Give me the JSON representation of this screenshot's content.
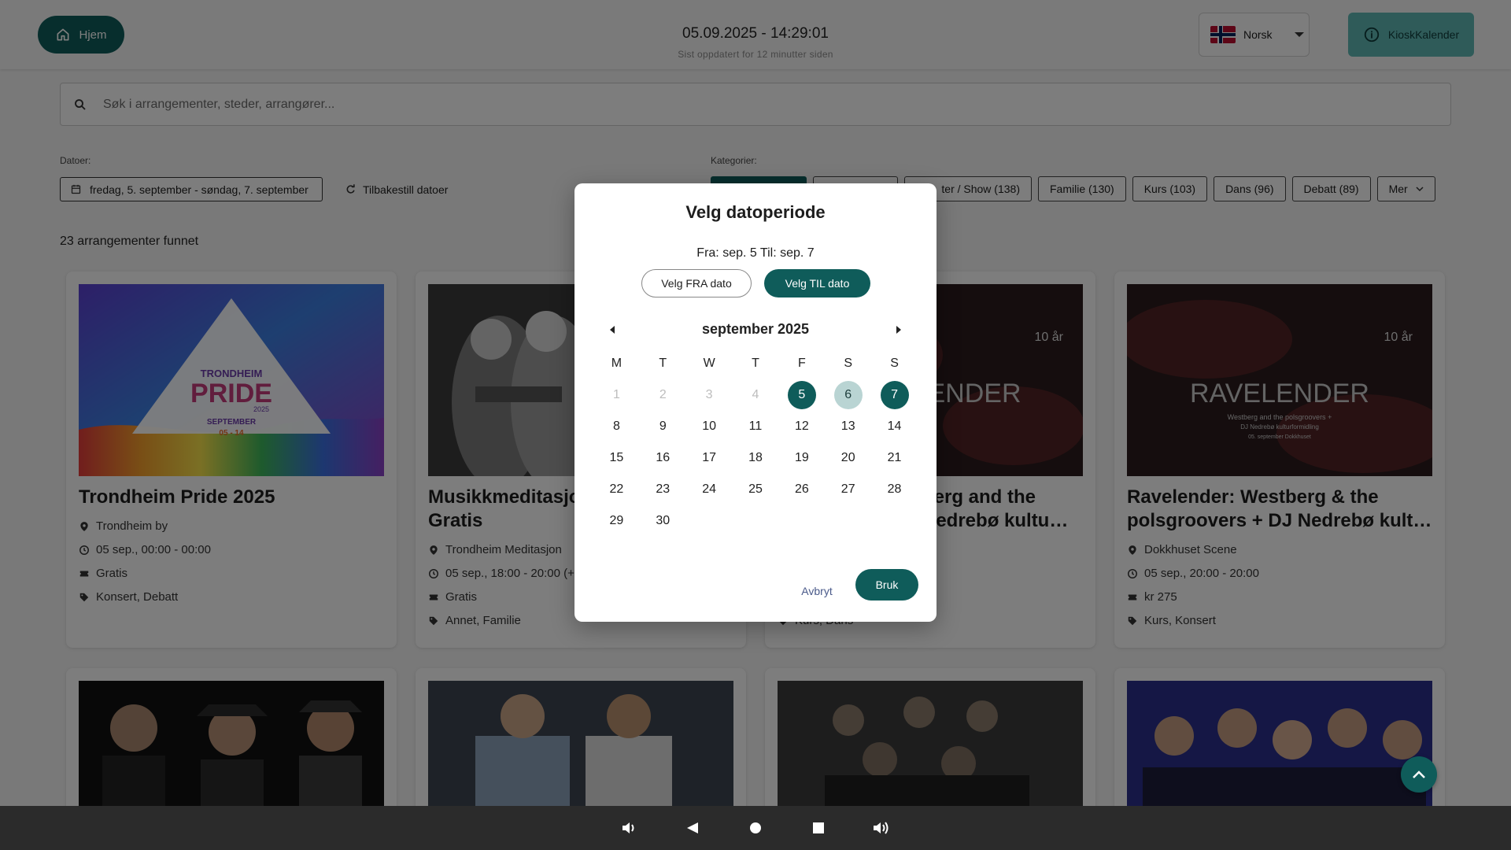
{
  "header": {
    "home_label": "Hjem",
    "datetime": "05.09.2025 - 14:29:01",
    "updated": "Sist oppdatert for 12 minutter siden",
    "language": "Norsk",
    "kiosk_label": "KioskKalender"
  },
  "search": {
    "placeholder": "Søk i arrangementer, steder, arrangører..."
  },
  "filters": {
    "dates_label": "Datoer:",
    "date_range": "fredag, 5. september - søndag, 7. september",
    "reset_label": "Tilbakestill datoer",
    "categories_label": "Kategorier:",
    "categories": [
      "",
      "",
      "ter / Show (138)",
      "Familie (130)",
      "Kurs (103)",
      "Dans (96)",
      "Debatt (89)"
    ],
    "more_label": "Mer"
  },
  "results_count": "23 arrangementer funnet",
  "cards": [
    {
      "title": "Trondheim Pride 2025",
      "location": "Trondheim by",
      "time": "05 sep., 00:00 - 00:00",
      "price": "Gratis",
      "tags": "Konsert, Debatt"
    },
    {
      "title": "Musikkmeditasjo\nGratis",
      "location": "Trondheim Meditasjon",
      "time": "05 sep., 18:00 - 20:00 (+",
      "price": "Gratis",
      "tags": "Annet, Familie"
    },
    {
      "title": "berg and the\n Nedrebø kultu…",
      "location": "",
      "time": "",
      "price": "",
      "tags": "Kurs, Dans"
    },
    {
      "title": "Ravelender: Westberg & the polsgroovers + DJ Nedrebø kult…",
      "location": "Dokkhuset Scene",
      "time": "05 sep., 20:00 - 20:00",
      "price": "kr 275",
      "tags": "Kurs, Konsert"
    }
  ],
  "card_images": {
    "pride_title_line1": "TRONDHEIM",
    "pride_title_line2": "PRIDE",
    "pride_year": "2025",
    "pride_month": "SEPTEMBER",
    "pride_dates": "05 - 14",
    "rave_badge": "10 år",
    "rave_title": "RAVELENDER",
    "rave_sub1": "Westberg and the polsgroovers +",
    "rave_sub2": "DJ Nedrebø kulturformidling",
    "rave_sub3": "05. september Dokkhuset",
    "rave3_title": "ENDER",
    "rave3_badge": "10 år"
  },
  "dialog": {
    "title": "Velg datoperiode",
    "range": "Fra: sep. 5 Til: sep. 7",
    "from_btn": "Velg FRA dato",
    "to_btn": "Velg TIL dato",
    "month": "september 2025",
    "weekdays": [
      "M",
      "T",
      "W",
      "T",
      "F",
      "S",
      "S"
    ],
    "days": [
      {
        "d": "1",
        "s": "muted"
      },
      {
        "d": "2",
        "s": "muted"
      },
      {
        "d": "3",
        "s": "muted"
      },
      {
        "d": "4",
        "s": "muted"
      },
      {
        "d": "5",
        "s": "sel"
      },
      {
        "d": "6",
        "s": "mid"
      },
      {
        "d": "7",
        "s": "sel"
      },
      {
        "d": "8"
      },
      {
        "d": "9"
      },
      {
        "d": "10"
      },
      {
        "d": "11"
      },
      {
        "d": "12"
      },
      {
        "d": "13"
      },
      {
        "d": "14"
      },
      {
        "d": "15"
      },
      {
        "d": "16"
      },
      {
        "d": "17"
      },
      {
        "d": "18"
      },
      {
        "d": "19"
      },
      {
        "d": "20"
      },
      {
        "d": "21"
      },
      {
        "d": "22"
      },
      {
        "d": "23"
      },
      {
        "d": "24"
      },
      {
        "d": "25"
      },
      {
        "d": "26"
      },
      {
        "d": "27"
      },
      {
        "d": "28"
      },
      {
        "d": "29"
      },
      {
        "d": "30"
      }
    ],
    "cancel": "Avbryt",
    "apply": "Bruk"
  },
  "colors": {
    "primary": "#0f5c5a",
    "kiosk": "#5fb7b3",
    "range_mid": "#b9d4d3"
  }
}
